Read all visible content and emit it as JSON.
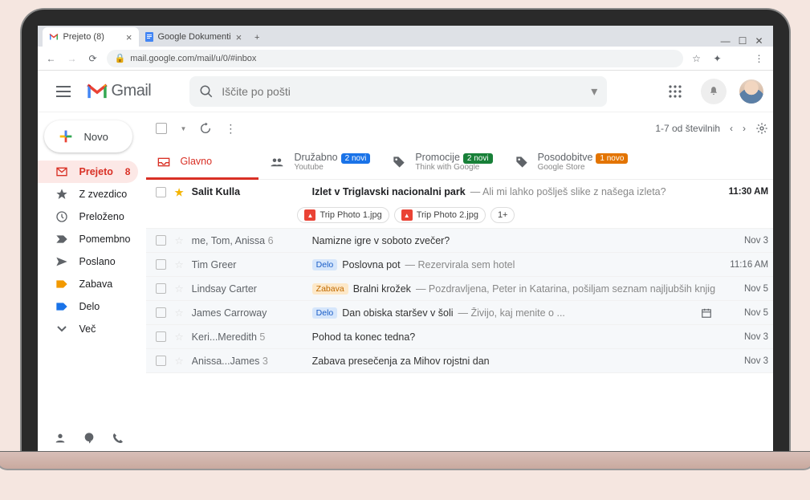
{
  "browser": {
    "tabs": [
      {
        "title": "Prejeto (8)",
        "favicon": "gmail"
      },
      {
        "title": "Google Dokumenti",
        "favicon": "docs"
      }
    ],
    "url": "mail.google.com/mail/u/0/#inbox"
  },
  "header": {
    "product": "Gmail",
    "search_placeholder": "Iščite po pošti"
  },
  "compose": {
    "label": "Novo"
  },
  "sidebar": {
    "items": [
      {
        "icon": "inbox",
        "label": "Prejeto",
        "count": "8",
        "active": true
      },
      {
        "icon": "star",
        "label": "Z zvezdico"
      },
      {
        "icon": "clock",
        "label": "Preloženo"
      },
      {
        "icon": "important",
        "label": "Pomembno"
      },
      {
        "icon": "sent",
        "label": "Poslano"
      },
      {
        "icon": "label-orange",
        "label": "Zabava"
      },
      {
        "icon": "label-blue",
        "label": "Delo"
      },
      {
        "icon": "chevron-down",
        "label": "Več"
      }
    ]
  },
  "toolbar": {
    "range": "1-7 od številnih"
  },
  "categories": [
    {
      "icon": "inbox",
      "label": "Glavno",
      "active": true
    },
    {
      "icon": "social",
      "label": "Družabno",
      "badge": "2 novi",
      "badge_color": "blue",
      "sub": "Youtube"
    },
    {
      "icon": "promo",
      "label": "Promocije",
      "badge": "2 novi",
      "badge_color": "green",
      "sub": "Think with Google"
    },
    {
      "icon": "updates",
      "label": "Posodobitve",
      "badge": "1 novo",
      "badge_color": "orange",
      "sub": "Google Store"
    }
  ],
  "emails": [
    {
      "unread": true,
      "starred": true,
      "sender": "Salit Kulla",
      "subject": "Izlet v Triglavski nacionalni park",
      "snippet": "Ali mi lahko pošlješ slike z našega izleta?",
      "date": "11:30 AM",
      "attachments": [
        "Trip Photo 1.jpg",
        "Trip Photo 2.jpg"
      ],
      "att_more": "1+"
    },
    {
      "unread": false,
      "sender": "me, Tom, Anissa",
      "sender_count": "6",
      "subject": "Namizne igre v soboto zvečer?",
      "date": "Nov 3"
    },
    {
      "unread": false,
      "sender": "Tim Greer",
      "label": "Delo",
      "label_color": "blue",
      "subject": "Poslovna pot",
      "snippet": "Rezervirala sem hotel",
      "date": "11:16 AM"
    },
    {
      "unread": false,
      "sender": "Lindsay Carter",
      "label": "Zabava",
      "label_color": "orange",
      "subject": "Bralni krožek",
      "snippet": "Pozdravljena, Peter in Katarina, pošiljam seznam najljubših knjig",
      "date": "Nov 5"
    },
    {
      "unread": false,
      "sender": "James Carroway",
      "label": "Delo",
      "label_color": "blue",
      "subject": "Dan obiska staršev v šoli",
      "snippet": "Živijo, kaj menite o ...",
      "date": "Nov 5",
      "has_event": true
    },
    {
      "unread": false,
      "sender": "Keri...Meredith",
      "sender_count": "5",
      "subject": "Pohod ta konec tedna?",
      "date": "Nov 3"
    },
    {
      "unread": false,
      "sender": "Anissa...James",
      "sender_count": "3",
      "subject": "Zabava presečenja za Mihov rojstni dan",
      "date": "Nov 3"
    }
  ]
}
